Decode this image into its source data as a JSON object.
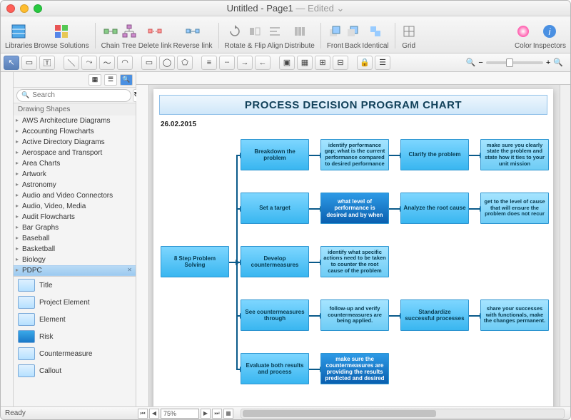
{
  "window": {
    "title_prefix": "Untitled - Page1",
    "title_suffix": " — Edited",
    "dropdown_glyph": "⌄"
  },
  "toolbar": {
    "libraries": "Libraries",
    "browse": "Browse Solutions",
    "chain": "Chain",
    "tree": "Tree",
    "delete_link": "Delete link",
    "reverse_link": "Reverse link",
    "rotate_flip": "Rotate & Flip",
    "align": "Align",
    "distribute": "Distribute",
    "front": "Front",
    "back": "Back",
    "identical": "Identical",
    "grid": "Grid",
    "color": "Color",
    "inspectors": "Inspectors"
  },
  "search": {
    "placeholder": "Search"
  },
  "sidebar": {
    "header": "Drawing Shapes",
    "items": [
      "AWS Architecture Diagrams",
      "Accounting Flowcharts",
      "Active Directory Diagrams",
      "Aerospace and Transport",
      "Area Charts",
      "Artwork",
      "Astronomy",
      "Audio and Video Connectors",
      "Audio, Video, Media",
      "Audit Flowcharts",
      "Bar Graphs",
      "Baseball",
      "Basketball",
      "Biology"
    ],
    "selected": "PDPC",
    "shapes": [
      "Title",
      "Project Element",
      "Element",
      "Risk",
      "Countermeasure",
      "Callout"
    ]
  },
  "chart": {
    "title": "PROCESS DECISION PROGRAM CHART",
    "date": "26.02.2015",
    "root": "8 Step Problem Solving",
    "rows": [
      {
        "a": "Breakdown the problem",
        "b": "identify performance gap; what is the current performance compared to desired performance",
        "c": "Clarify the problem",
        "d": "make sure you clearly state the problem and state how it ties to your unit mission"
      },
      {
        "a": "Set a target",
        "b": "what level of performance is desired and by when",
        "c": "Analyze the root cause",
        "d": "get to the level of cause that will ensure the problem does not recur"
      },
      {
        "a": "Develop countermeasures",
        "b": "identify what specific actions need to be taken to counter the root cause of the problem",
        "c": "",
        "d": ""
      },
      {
        "a": "See countermeasures through",
        "b": "follow-up and verify countermeasures are being applied.",
        "c": "Standardize successful processes",
        "d": "share your successes with functionals, make the changes permanent."
      },
      {
        "a": "Evaluate both results and process",
        "b": "make sure the countermeasures are providing the results predicted and desired",
        "c": "",
        "d": ""
      }
    ]
  },
  "status": {
    "ready": "Ready",
    "zoom": "75%"
  },
  "icons": {
    "search": "🔍",
    "refresh": "↻",
    "minus": "−",
    "plus": "+",
    "mag": "🔍",
    "left": "◀",
    "right": "▶",
    "first": "⏮",
    "last": "⏭"
  }
}
